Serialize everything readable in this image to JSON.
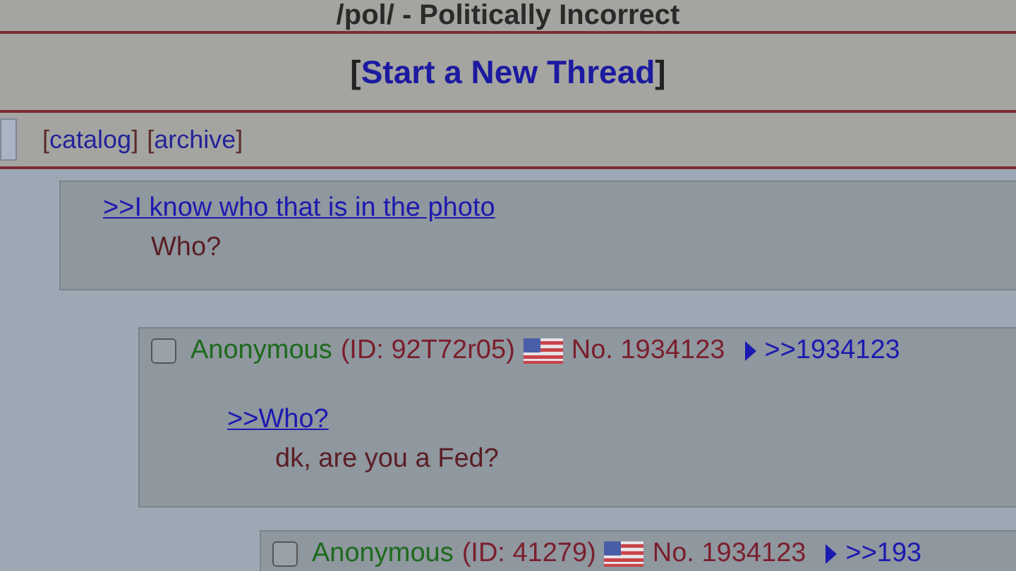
{
  "board_title": "/pol/ - Politically Incorrect",
  "new_thread": {
    "open": "[",
    "label": "Start a New Thread",
    "close": "]"
  },
  "nav_links": [
    {
      "open": "[",
      "label": "catalog",
      "close": "]"
    },
    {
      "open": "[",
      "label": "archive",
      "close": "]"
    }
  ],
  "posts": [
    {
      "kind": "quote",
      "quote_link": ">>I know who that is in the photo",
      "comment": "Who?"
    },
    {
      "kind": "reply",
      "checked": false,
      "name": "Anonymous",
      "poster_id": "(ID: 92T72r05)",
      "number": "No. 1934123",
      "backlink": ">>1934123",
      "quote_link": ">>Who?",
      "comment": "dk, are you a Fed?"
    },
    {
      "kind": "reply",
      "checked": false,
      "name": "Anonymous",
      "poster_id": "(ID: 41279)",
      "number": "No. 1934123",
      "backlink": ">>193"
    }
  ]
}
